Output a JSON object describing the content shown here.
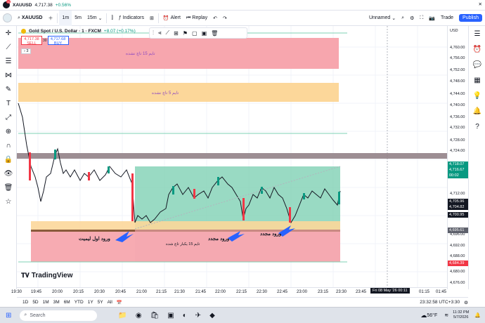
{
  "topbar": {
    "symbol": "XAUUSD",
    "price": "4,717.38",
    "change": "+0.56%",
    "notif_count": "11"
  },
  "toolbar": {
    "symbol": "XAUUSD",
    "tf": [
      "1m",
      "5m",
      "15m"
    ],
    "indicators": "Indicators",
    "alert": "Alert",
    "replay": "Replay",
    "layout": "Unnamed",
    "trade": "Trade",
    "publish": "Publish"
  },
  "legend": {
    "title": "Gold Spot / U.S. Dollar · 1 · FXCM",
    "change": "+8.07 (+0.17%)"
  },
  "orders": {
    "sell_price": "4,717.38",
    "sell_label": "SELL",
    "spread": "30",
    "buy_price": "4,717.68",
    "buy_label": "BUY",
    "count": "3"
  },
  "annotations": {
    "zone15": "تایم 15 تاچ نشده",
    "zone5": "تایم 5 تاچ نشده",
    "entry1": "ورود اول لیمیت",
    "entry2": "ورود مجدد",
    "entry3": "ورود مجدد",
    "touched15": "تایم 15 یکبار تاچ شده"
  },
  "price_axis": {
    "currency": "USD",
    "labels": [
      "4,760.00",
      "4,756.00",
      "4,752.00",
      "4,748.00",
      "4,744.00",
      "4,740.00",
      "4,736.00",
      "4,732.00",
      "4,728.00",
      "4,724.00",
      "4,720.00",
      "4,712.00",
      "4,708.00",
      "4,696.00",
      "4,692.00",
      "4,688.00",
      "4,680.00",
      "4,676.00"
    ],
    "tags": {
      "green": "4,718.07",
      "green2": "4,716.67",
      "countdown": "00:02",
      "cur": "4,705.96",
      "c2": "4,704.82",
      "c3": "4,700.95",
      "grey": "4,695.61",
      "red": "4,684.39"
    }
  },
  "time_axis": {
    "labels": [
      "19:30",
      "19:45",
      "20:00",
      "20:15",
      "20:30",
      "20:45",
      "21:00",
      "21:15",
      "21:30",
      "21:45",
      "22:00",
      "22:15",
      "22:30",
      "22:45",
      "23:00",
      "23:15",
      "23:30",
      "23:45",
      "00:11",
      "01:15",
      "01:45"
    ],
    "cursor": "Fri 08 May '26   00:11"
  },
  "bottombar": {
    "ranges": [
      "1D",
      "5D",
      "1M",
      "3M",
      "6M",
      "YTD",
      "1Y",
      "5Y",
      "All"
    ],
    "clock": "23:32:58 UTC+3:30"
  },
  "brand": "TradingView",
  "taskbar": {
    "search": "Search",
    "temp": "56°F",
    "time": "11:32 PM",
    "date": "5/7/2026"
  },
  "colors": {
    "red_zone": "#f7a6ae",
    "orange_zone": "#fcd79a",
    "green_zone": "#7fd1b4",
    "accent": "#2962ff"
  }
}
